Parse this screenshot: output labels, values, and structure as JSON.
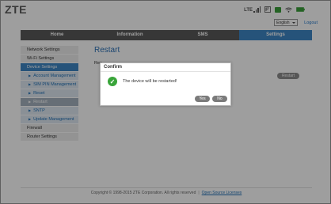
{
  "brand": {
    "logo": "ZTE"
  },
  "status": {
    "network_type": "LTE",
    "colors": {
      "sim": "#3aa03a",
      "wifi": "#555555",
      "battery": "#3aa03a"
    }
  },
  "header": {
    "language": "English",
    "logout": "Logout"
  },
  "nav": {
    "tabs": [
      "Home",
      "Information",
      "SMS",
      "Settings"
    ],
    "active": "Settings"
  },
  "sidebar": {
    "network_settings": "Network Settings",
    "wifi_settings": "Wi-Fi Settings",
    "device_settings": "Device Settings",
    "sub": {
      "account": "Account Management",
      "sim_pin": "SIM PIN Management",
      "reset": "Reset",
      "restart": "Restart",
      "sntp": "SNTP",
      "update": "Update Management"
    },
    "firewall": "Firewall",
    "router": "Router Settings"
  },
  "main": {
    "title": "Restart",
    "description_partial": "Res",
    "restart_button": "Restart"
  },
  "dialog": {
    "title": "Confirm",
    "message": "The device will be restarted!",
    "yes": "Yes",
    "no": "No"
  },
  "footer": {
    "copyright": "Copyright © 1998-2015 ZTE Corporation. All rights reserved",
    "separator": "|",
    "license": "Open Source Licenses"
  },
  "colors": {
    "accent": "#3e87c6",
    "nav_bg": "#5a5a5a",
    "success": "#39a53a"
  }
}
